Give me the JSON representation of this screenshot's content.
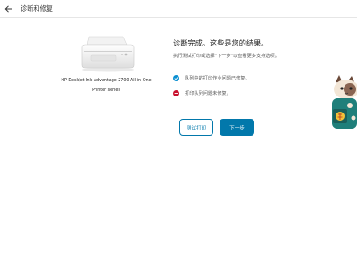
{
  "header": {
    "back_icon": "arrow-left-icon",
    "title": "诊断和修复"
  },
  "product": {
    "name": "HP DeskJet Ink Advantage 2700 All-in-One Printer series"
  },
  "result": {
    "title": "诊断完成。这些是您的结果。",
    "subtitle": "执行测试打印或选择\"下一步\"以查看更多支持选项。",
    "items": [
      {
        "text": "队列中的打印作业问题已修复。",
        "status": "fixed",
        "icon": "check-circle-icon",
        "color": "#0a8fd1"
      },
      {
        "text": "打印队列问题未修复。",
        "status": "not-fixed",
        "icon": "minus-circle-icon",
        "color": "#c8102e"
      }
    ]
  },
  "buttons": {
    "test_print": "测试打印",
    "next": "下一步"
  },
  "colors": {
    "accent": "#0278ab"
  }
}
